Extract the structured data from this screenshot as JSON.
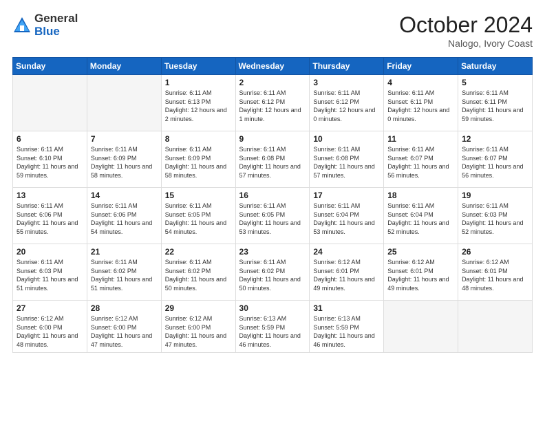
{
  "header": {
    "logo_general": "General",
    "logo_blue": "Blue",
    "month_title": "October 2024",
    "subtitle": "Nalogo, Ivory Coast"
  },
  "days_of_week": [
    "Sunday",
    "Monday",
    "Tuesday",
    "Wednesday",
    "Thursday",
    "Friday",
    "Saturday"
  ],
  "weeks": [
    [
      {
        "day": "",
        "empty": true
      },
      {
        "day": "",
        "empty": true
      },
      {
        "day": "1",
        "sunrise": "Sunrise: 6:11 AM",
        "sunset": "Sunset: 6:13 PM",
        "daylight": "Daylight: 12 hours and 2 minutes."
      },
      {
        "day": "2",
        "sunrise": "Sunrise: 6:11 AM",
        "sunset": "Sunset: 6:12 PM",
        "daylight": "Daylight: 12 hours and 1 minute."
      },
      {
        "day": "3",
        "sunrise": "Sunrise: 6:11 AM",
        "sunset": "Sunset: 6:12 PM",
        "daylight": "Daylight: 12 hours and 0 minutes."
      },
      {
        "day": "4",
        "sunrise": "Sunrise: 6:11 AM",
        "sunset": "Sunset: 6:11 PM",
        "daylight": "Daylight: 12 hours and 0 minutes."
      },
      {
        "day": "5",
        "sunrise": "Sunrise: 6:11 AM",
        "sunset": "Sunset: 6:11 PM",
        "daylight": "Daylight: 11 hours and 59 minutes."
      }
    ],
    [
      {
        "day": "6",
        "sunrise": "Sunrise: 6:11 AM",
        "sunset": "Sunset: 6:10 PM",
        "daylight": "Daylight: 11 hours and 59 minutes."
      },
      {
        "day": "7",
        "sunrise": "Sunrise: 6:11 AM",
        "sunset": "Sunset: 6:09 PM",
        "daylight": "Daylight: 11 hours and 58 minutes."
      },
      {
        "day": "8",
        "sunrise": "Sunrise: 6:11 AM",
        "sunset": "Sunset: 6:09 PM",
        "daylight": "Daylight: 11 hours and 58 minutes."
      },
      {
        "day": "9",
        "sunrise": "Sunrise: 6:11 AM",
        "sunset": "Sunset: 6:08 PM",
        "daylight": "Daylight: 11 hours and 57 minutes."
      },
      {
        "day": "10",
        "sunrise": "Sunrise: 6:11 AM",
        "sunset": "Sunset: 6:08 PM",
        "daylight": "Daylight: 11 hours and 57 minutes."
      },
      {
        "day": "11",
        "sunrise": "Sunrise: 6:11 AM",
        "sunset": "Sunset: 6:07 PM",
        "daylight": "Daylight: 11 hours and 56 minutes."
      },
      {
        "day": "12",
        "sunrise": "Sunrise: 6:11 AM",
        "sunset": "Sunset: 6:07 PM",
        "daylight": "Daylight: 11 hours and 56 minutes."
      }
    ],
    [
      {
        "day": "13",
        "sunrise": "Sunrise: 6:11 AM",
        "sunset": "Sunset: 6:06 PM",
        "daylight": "Daylight: 11 hours and 55 minutes."
      },
      {
        "day": "14",
        "sunrise": "Sunrise: 6:11 AM",
        "sunset": "Sunset: 6:06 PM",
        "daylight": "Daylight: 11 hours and 54 minutes."
      },
      {
        "day": "15",
        "sunrise": "Sunrise: 6:11 AM",
        "sunset": "Sunset: 6:05 PM",
        "daylight": "Daylight: 11 hours and 54 minutes."
      },
      {
        "day": "16",
        "sunrise": "Sunrise: 6:11 AM",
        "sunset": "Sunset: 6:05 PM",
        "daylight": "Daylight: 11 hours and 53 minutes."
      },
      {
        "day": "17",
        "sunrise": "Sunrise: 6:11 AM",
        "sunset": "Sunset: 6:04 PM",
        "daylight": "Daylight: 11 hours and 53 minutes."
      },
      {
        "day": "18",
        "sunrise": "Sunrise: 6:11 AM",
        "sunset": "Sunset: 6:04 PM",
        "daylight": "Daylight: 11 hours and 52 minutes."
      },
      {
        "day": "19",
        "sunrise": "Sunrise: 6:11 AM",
        "sunset": "Sunset: 6:03 PM",
        "daylight": "Daylight: 11 hours and 52 minutes."
      }
    ],
    [
      {
        "day": "20",
        "sunrise": "Sunrise: 6:11 AM",
        "sunset": "Sunset: 6:03 PM",
        "daylight": "Daylight: 11 hours and 51 minutes."
      },
      {
        "day": "21",
        "sunrise": "Sunrise: 6:11 AM",
        "sunset": "Sunset: 6:02 PM",
        "daylight": "Daylight: 11 hours and 51 minutes."
      },
      {
        "day": "22",
        "sunrise": "Sunrise: 6:11 AM",
        "sunset": "Sunset: 6:02 PM",
        "daylight": "Daylight: 11 hours and 50 minutes."
      },
      {
        "day": "23",
        "sunrise": "Sunrise: 6:11 AM",
        "sunset": "Sunset: 6:02 PM",
        "daylight": "Daylight: 11 hours and 50 minutes."
      },
      {
        "day": "24",
        "sunrise": "Sunrise: 6:12 AM",
        "sunset": "Sunset: 6:01 PM",
        "daylight": "Daylight: 11 hours and 49 minutes."
      },
      {
        "day": "25",
        "sunrise": "Sunrise: 6:12 AM",
        "sunset": "Sunset: 6:01 PM",
        "daylight": "Daylight: 11 hours and 49 minutes."
      },
      {
        "day": "26",
        "sunrise": "Sunrise: 6:12 AM",
        "sunset": "Sunset: 6:01 PM",
        "daylight": "Daylight: 11 hours and 48 minutes."
      }
    ],
    [
      {
        "day": "27",
        "sunrise": "Sunrise: 6:12 AM",
        "sunset": "Sunset: 6:00 PM",
        "daylight": "Daylight: 11 hours and 48 minutes."
      },
      {
        "day": "28",
        "sunrise": "Sunrise: 6:12 AM",
        "sunset": "Sunset: 6:00 PM",
        "daylight": "Daylight: 11 hours and 47 minutes."
      },
      {
        "day": "29",
        "sunrise": "Sunrise: 6:12 AM",
        "sunset": "Sunset: 6:00 PM",
        "daylight": "Daylight: 11 hours and 47 minutes."
      },
      {
        "day": "30",
        "sunrise": "Sunrise: 6:13 AM",
        "sunset": "Sunset: 5:59 PM",
        "daylight": "Daylight: 11 hours and 46 minutes."
      },
      {
        "day": "31",
        "sunrise": "Sunrise: 6:13 AM",
        "sunset": "Sunset: 5:59 PM",
        "daylight": "Daylight: 11 hours and 46 minutes."
      },
      {
        "day": "",
        "empty": true
      },
      {
        "day": "",
        "empty": true
      }
    ]
  ]
}
